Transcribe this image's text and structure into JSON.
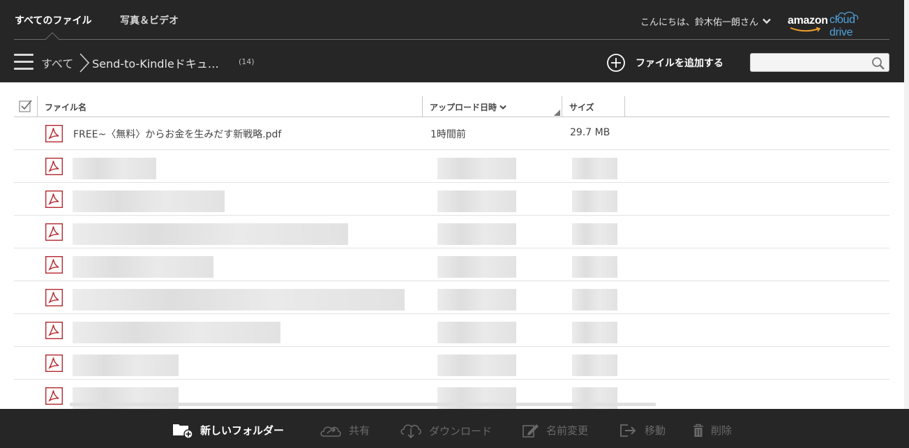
{
  "tabs": [
    {
      "label": "すべてのファイル",
      "active": true
    },
    {
      "label": "写真＆ビデオ",
      "active": false
    }
  ],
  "header": {
    "greeting": "こんにちは、鈴木佑一朗さん",
    "logo_amazon": "amazon",
    "logo_cloud": "cloud drive"
  },
  "breadcrumb": {
    "root": "すべて",
    "folder": "Send-to-Kindleドキュ…",
    "count": "(14)"
  },
  "actions": {
    "add_file": "ファイルを追加する"
  },
  "search": {
    "placeholder": "",
    "value": ""
  },
  "columns": {
    "name": "ファイル名",
    "date": "アップロード日時",
    "size": "サイズ"
  },
  "files": [
    {
      "name": "FREE~〈無料〉からお金を生みだす新戦略.pdf",
      "uploaded": "1時間前",
      "size": "29.7 MB"
    }
  ],
  "toolbar": {
    "new_folder": "新しいフォルダー",
    "share": "共有",
    "download": "ダウンロード",
    "rename": "名前変更",
    "move": "移動",
    "delete": "削除"
  },
  "colors": {
    "bar_bg": "#262626",
    "accent_blue": "#4fa3de",
    "pdf_red": "#b4282e"
  }
}
